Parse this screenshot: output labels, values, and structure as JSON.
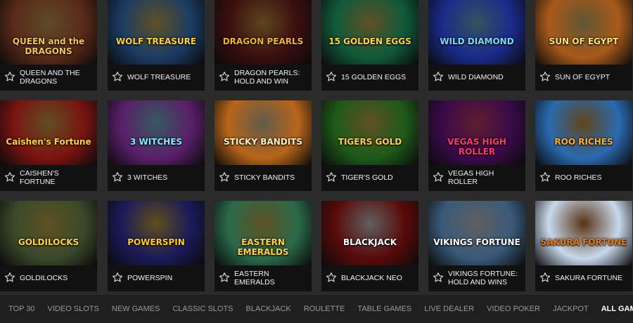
{
  "games": [
    {
      "title": "QUEEN AND THE DRAGONS",
      "logo": "QUEEN and the DRAGONS",
      "bg": "#5a2a18",
      "accent": "#f3c45a"
    },
    {
      "title": "WOLF TREASURE",
      "logo": "WOLF TREASURE",
      "bg": "#1b3c63",
      "accent": "#ffd24a"
    },
    {
      "title": "DRAGON PEARLS: HOLD AND WIN",
      "logo": "DRAGON PEARLS",
      "bg": "#3a0e0e",
      "accent": "#f2b23a"
    },
    {
      "title": "15 GOLDEN EGGS",
      "logo": "15 GOLDEN EGGS",
      "bg": "#0f5a3a",
      "accent": "#ffd34d"
    },
    {
      "title": "WILD DIAMOND",
      "logo": "WILD DIAMOND",
      "bg": "#1a2a8a",
      "accent": "#7fd8ff"
    },
    {
      "title": "SUN OF EGYPT",
      "logo": "SUN OF EGYPT",
      "bg": "#a85a1a",
      "accent": "#ffe07a"
    },
    {
      "title": "CAISHEN'S FORTUNE",
      "logo": "Caishen's Fortune",
      "bg": "#7a1410",
      "accent": "#ffd04a"
    },
    {
      "title": "3 WITCHES",
      "logo": "3 WITCHES",
      "bg": "#5a1f6a",
      "accent": "#7ff0ff"
    },
    {
      "title": "STICKY BANDITS",
      "logo": "STICKY BANDITS",
      "bg": "#b8651a",
      "accent": "#fff2c0"
    },
    {
      "title": "TIGER'S GOLD",
      "logo": "TIGERS GOLD",
      "bg": "#1e5a1a",
      "accent": "#ffd24a"
    },
    {
      "title": "VEGAS HIGH ROLLER",
      "logo": "VEGAS HIGH ROLLER",
      "bg": "#3a0a4a",
      "accent": "#ff3a6a"
    },
    {
      "title": "ROO RICHES",
      "logo": "ROO RICHES",
      "bg": "#2a6ab0",
      "accent": "#ffb02a"
    },
    {
      "title": "GOLDILOCKS",
      "logo": "GOLDILOCKS",
      "bg": "#3a4a2a",
      "accent": "#ffd24a"
    },
    {
      "title": "POWERSPIN",
      "logo": "POWERSPIN",
      "bg": "#1a1a5a",
      "accent": "#ffcc2a"
    },
    {
      "title": "EASTERN EMERALDS",
      "logo": "EASTERN EMERALDS",
      "bg": "#2a6a4a",
      "accent": "#ffd24a"
    },
    {
      "title": "BLACKJACK NEO",
      "logo": "BLACKJACK",
      "bg": "#5a0a0a",
      "accent": "#ffffff"
    },
    {
      "title": "VIKINGS FORTUNE: HOLD AND WINS",
      "logo": "VIKINGS FORTUNE",
      "bg": "#3a5a7a",
      "accent": "#ffffff"
    },
    {
      "title": "SAKURA FORTUNE",
      "logo": "SAKURA FORTUNE",
      "bg": "#c8d8ec",
      "accent": "#e87a1a"
    }
  ],
  "nav": [
    {
      "label": "TOP 30"
    },
    {
      "label": "VIDEO SLOTS"
    },
    {
      "label": "NEW GAMES"
    },
    {
      "label": "CLASSIC SLOTS"
    },
    {
      "label": "BLACKJACK"
    },
    {
      "label": "ROULETTE"
    },
    {
      "label": "TABLE GAMES"
    },
    {
      "label": "LIVE DEALER"
    },
    {
      "label": "VIDEO POKER"
    },
    {
      "label": "JACKPOT"
    },
    {
      "label": "ALL GAMES",
      "active": true
    }
  ],
  "icons": {
    "favorite": "star-outline-icon"
  }
}
